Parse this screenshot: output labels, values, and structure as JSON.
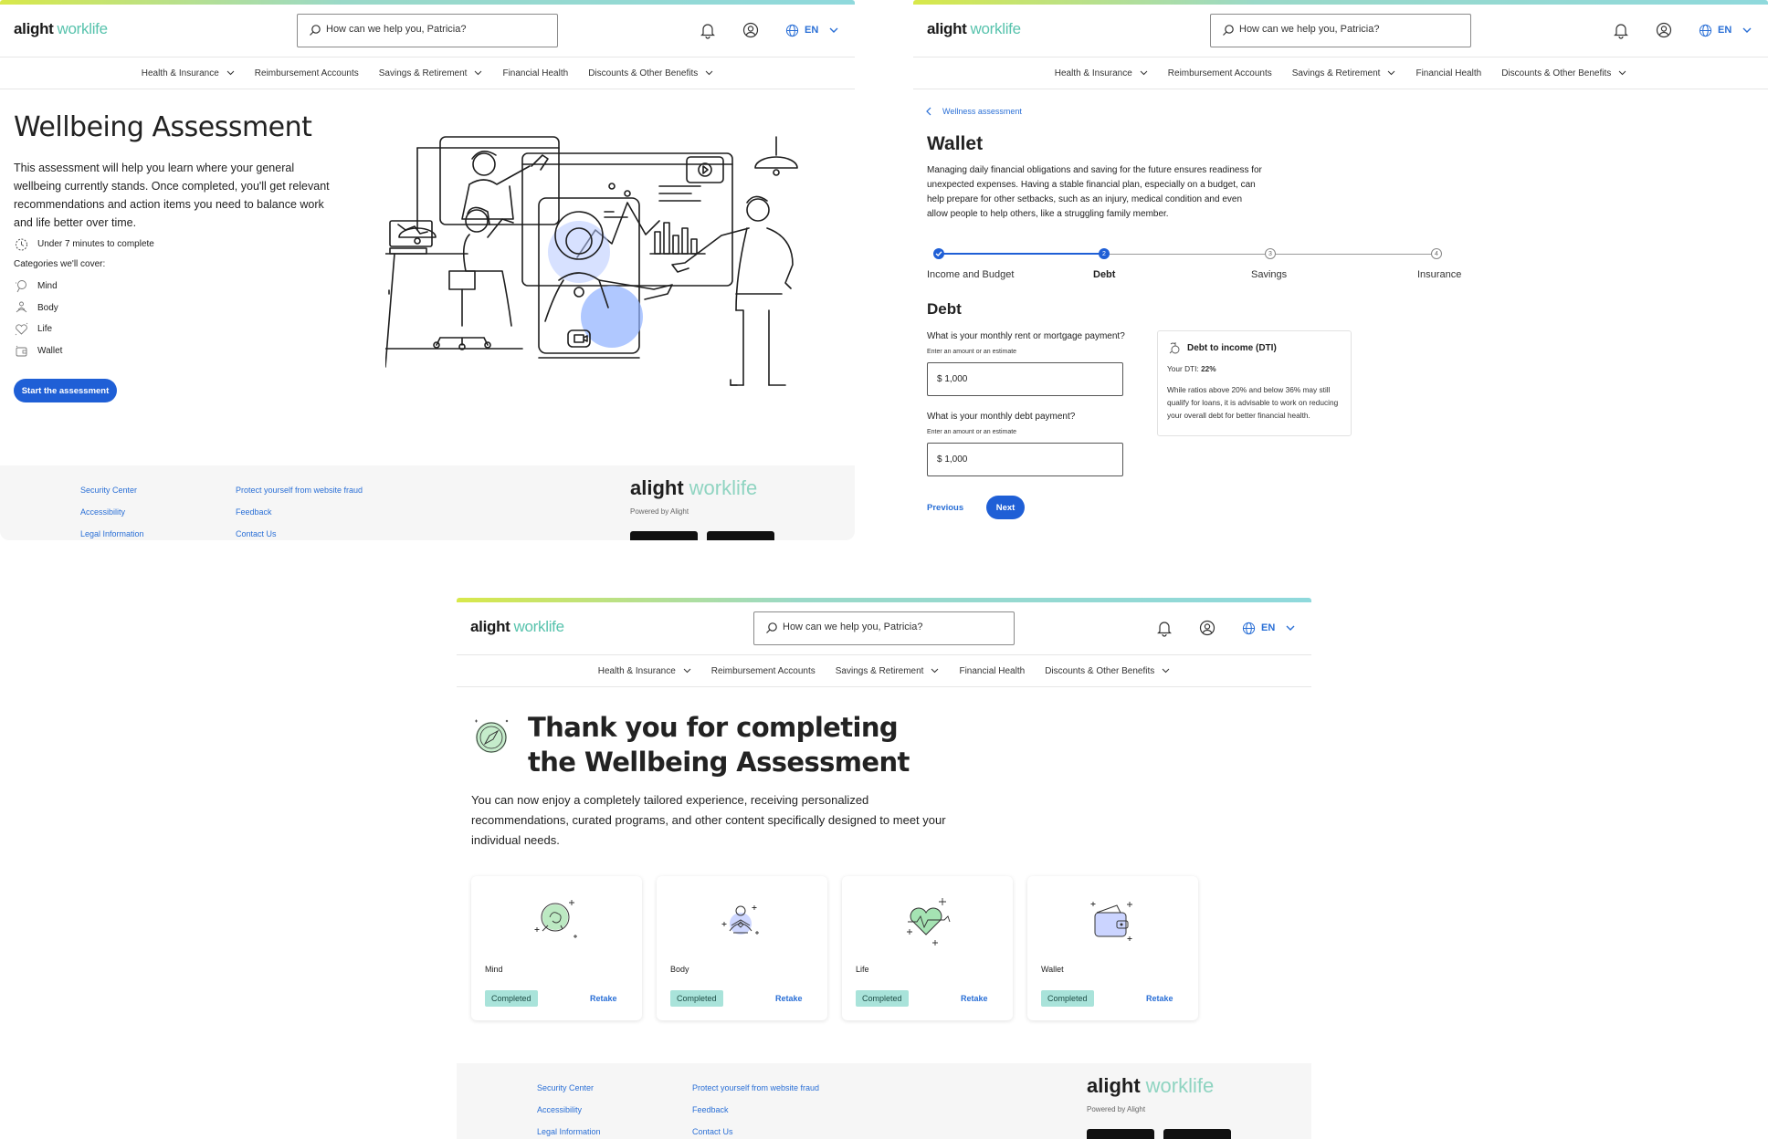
{
  "header": {
    "logo_alight": "alight",
    "logo_worklife": "worklife",
    "search_placeholder": "How can we help you, Patricia?",
    "lang": "EN"
  },
  "nav": [
    {
      "label": "Health & Insurance",
      "dropdown": true
    },
    {
      "label": "Reimbursement Accounts",
      "dropdown": false
    },
    {
      "label": "Savings & Retirement",
      "dropdown": true
    },
    {
      "label": "Financial Health",
      "dropdown": false
    },
    {
      "label": "Discounts & Other Benefits",
      "dropdown": true
    }
  ],
  "intro_page": {
    "title": "Wellbeing Assessment",
    "description": "This assessment will help you learn where your general wellbeing currently stands. Once completed, you'll get relevant recommendations and action items you need to balance work and life better over time.",
    "duration": "Under 7 minutes to complete",
    "categories_label": "Categories we'll cover:",
    "categories": [
      "Mind",
      "Body",
      "Life",
      "Wallet"
    ],
    "start_button": "Start the assessment"
  },
  "footer": {
    "links_col1": [
      "Security Center",
      "Accessibility",
      "Legal Information"
    ],
    "links_col2": [
      "Protect yourself from website fraud",
      "Feedback",
      "Contact Us"
    ],
    "logo_alight": "alight",
    "logo_worklife": "worklife",
    "powered_by": "Powered by Alight"
  },
  "wallet_page": {
    "breadcrumb": "Wellness assessment",
    "title": "Wallet",
    "description": "Managing daily financial obligations and saving for the future ensures readiness for unexpected expenses. Having a stable financial plan, especially on a budget, can help prepare for other setbacks, such as an injury, medical condition and even allow people to help others, like a struggling family member.",
    "steps": [
      {
        "label": "Income and Budget",
        "state": "done",
        "num": "1"
      },
      {
        "label": "Debt",
        "state": "current",
        "num": "2"
      },
      {
        "label": "Savings",
        "state": "todo",
        "num": "3"
      },
      {
        "label": "Insurance",
        "state": "todo",
        "num": "4"
      }
    ],
    "section_title": "Debt",
    "q1": "What is your monthly rent or mortgage payment?",
    "q1_hint": "Enter an amount or an estimate",
    "q1_value": "$ 1,000",
    "q2": "What is your monthly debt payment?",
    "q2_hint": "Enter an amount or an estimate",
    "q2_value": "$ 1,000",
    "dti_title": "Debt to income (DTI)",
    "dti_label": "Your DTI:",
    "dti_value": "22%",
    "dti_body": "While ratios above 20% and below 36% may still qualify for loans, it is advisable to work on reducing your overall debt for better financial health.",
    "prev_button": "Previous",
    "next_button": "Next"
  },
  "thankyou_page": {
    "title": "Thank you for completing the Wellbeing Assessment",
    "description": "You can now enjoy a completely tailored experience, receiving personalized recommendations, curated programs, and other content specifically designed to meet your individual needs.",
    "cards": [
      {
        "name": "Mind",
        "status": "Completed",
        "action": "Retake",
        "icon": "brain-icon"
      },
      {
        "name": "Body",
        "status": "Completed",
        "action": "Retake",
        "icon": "meditation-icon"
      },
      {
        "name": "Life",
        "status": "Completed",
        "action": "Retake",
        "icon": "heart-icon"
      },
      {
        "name": "Wallet",
        "status": "Completed",
        "action": "Retake",
        "icon": "wallet-icon"
      }
    ]
  },
  "colors": {
    "primary": "#1f5fd6",
    "link": "#2a6fd6",
    "brand_green": "#58c3ad",
    "status_teal": "#a9e3da"
  }
}
